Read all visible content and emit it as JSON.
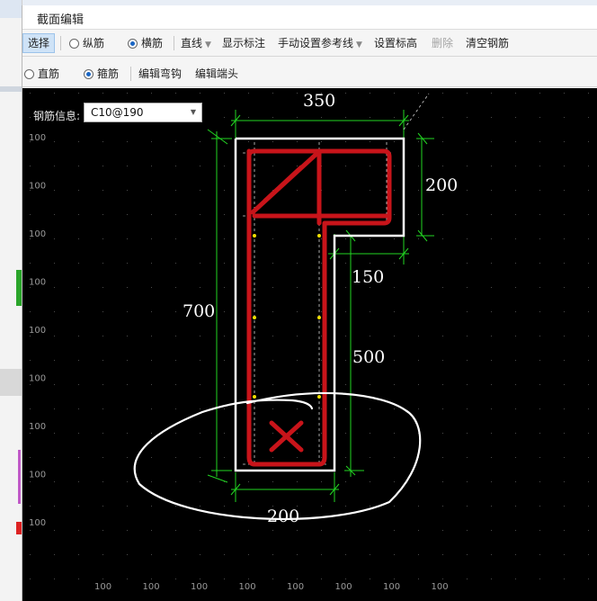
{
  "dialog": {
    "title": "截面编辑"
  },
  "toolbar1": {
    "select": "选择",
    "longitudinal": "纵筋",
    "transverse": "横筋",
    "line_mode": "直线",
    "show_dims": "显示标注",
    "manual_ref": "手动设置参考线",
    "set_elev": "设置标高",
    "delete": "删除",
    "clear": "清空钢筋",
    "active_radio": "transverse"
  },
  "toolbar2": {
    "straight": "直筋",
    "stirrup": "箍筋",
    "edit_hook": "编辑弯钩",
    "edit_end": "编辑端头",
    "active_radio": "stirrup"
  },
  "rebar_info": {
    "label": "钢筋信息:",
    "value": "C10@190"
  },
  "dimensions": {
    "top": "350",
    "right_top": "200",
    "step": "150",
    "left": "700",
    "right_lower": "500",
    "bottom": "200"
  },
  "grid": {
    "left_labels": [
      "100",
      "100",
      "100",
      "100",
      "100",
      "100",
      "100",
      "100",
      "100"
    ],
    "bottom_labels": [
      "100",
      "100",
      "100",
      "100",
      "100",
      "100",
      "100",
      "100"
    ]
  },
  "colors": {
    "canvas": "#000000",
    "outline": "#ffffff",
    "rebar": "#c8141a",
    "dimension": "#22d622",
    "reference": "#ffffff",
    "annotation": "#ffffff"
  },
  "icons": [
    "radio-icon",
    "dropdown-caret-icon"
  ]
}
